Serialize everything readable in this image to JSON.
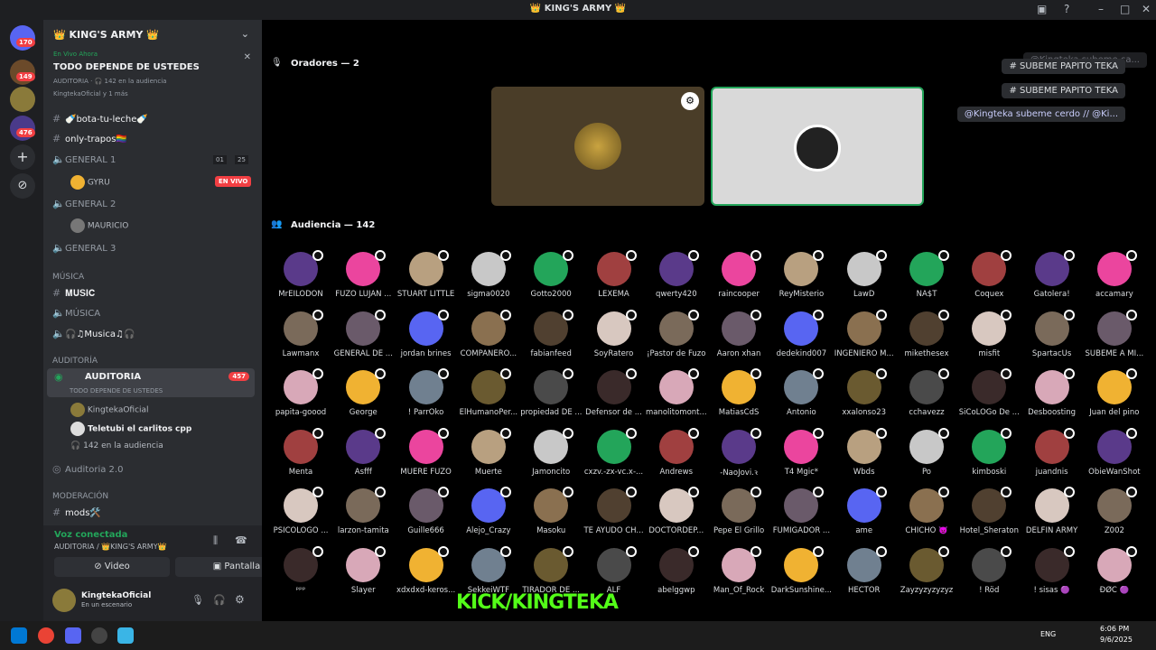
{
  "window": {
    "title": "👑 KING'S ARMY 👑"
  },
  "guilds": {
    "badges": [
      "170",
      "149",
      "476"
    ]
  },
  "server": {
    "name": "👑 KING'S ARMY 👑"
  },
  "live_banner": {
    "status": "En Vivo Ahora",
    "title": "TODO DEPENDE DE USTEDES",
    "sub1": "AUDITORIA · 🎧 142 en la audiencia",
    "sub2": "KingtekaOficial y 1 más"
  },
  "channels": {
    "bota": "🍼bota-tu-leche🍼",
    "only": "only-trapos🏳️‍🌈",
    "general1": "GENERAL 1",
    "general1_counts": [
      "01",
      "25"
    ],
    "gyru": "GYRU",
    "en_vivo": "EN VIVO",
    "general2": "GENERAL 2",
    "mauricio": "MAURICIO",
    "general3": "GENERAL 3",
    "musica_cat": "MÚSICA",
    "music": "𝐌𝐔𝐒𝐈𝐂",
    "musica": "MÚSICA",
    "musica2": "🎧♫Musica♫🎧",
    "auditoria_cat": "AUDITORÍA",
    "auditoria": "AUDITORIA",
    "auditoria_count": "457",
    "auditoria_topic": "TODO DEPENDE DE USTEDES",
    "user1": "KingtekaOficial",
    "user2": "Teletubi el carlitos cpp",
    "audience": "142 en la audiencia",
    "auditoria2": "Auditoria 2.0",
    "moderacion_cat": "MODERACIÓN",
    "mods": "mods🛠️"
  },
  "voice": {
    "status": "Voz conectada",
    "location": "AUDITORIA / 👑KING'S ARMY👑",
    "video": "Video",
    "screen": "Pantalla"
  },
  "user": {
    "name": "KingtekaOficial",
    "status": "En un escenario"
  },
  "stage": {
    "speakers_title": "Oradores — 2",
    "audience_title": "Audiencia — 142"
  },
  "chat": [
    "@Kingteka subeme ca...",
    "# SUBEME PAPITO TEKA",
    "# SUBEME PAPITO TEKA",
    "@Kingteka subeme cerdo // @Ki..."
  ],
  "audience": [
    [
      "MrEILODON",
      "FUZO LUJAN ...",
      "STUART LITTLE",
      "sigma0020",
      "Gotto2000",
      "LEXEMA",
      "qwerty420",
      "raincooper",
      "ReyMisterio",
      "LawD",
      "NA$T",
      "Coquex",
      "Gatolera!",
      "accamary"
    ],
    [
      "Lawmanx",
      "GENERAL DE ...",
      "jordan brines",
      "COMPAÑERO...",
      "fabianfeed",
      "SoyRatero",
      "¡Pastor de Fuzo",
      "Aaron xhan",
      "dedekind007",
      "INGENIERO M...",
      "mikethesex",
      "misfit",
      "SpartacUs",
      "SUBEME A MI..."
    ],
    [
      "papita-goood",
      "George",
      "! ParrOko",
      "ElHumanoPer...",
      "propiedad DE ...",
      "Defensor de ...",
      "manolitomont...",
      "MatiasCdS",
      "Antonio",
      "xxalonso23",
      "cchavezz",
      "SiCoLOGo De ...",
      "Desboosting",
      "Juan del pino"
    ],
    [
      "Menta",
      "Asfff",
      "MUERE FUZO",
      "Muerte",
      "Jamoncito",
      "cxzv.-zx-vc.x-...",
      "Andrews",
      "-NaoJovi.ꝛ",
      "T4 Mgic*",
      "Wbds",
      "Po",
      "kimboski",
      "juandnis",
      "ObieWanShot"
    ],
    [
      "PSICOLOGO ...",
      "larzon-tamita",
      "Guille666",
      "Alejo_Crazy",
      "Masoku",
      "TE AYUDO CH...",
      "DOCTORDEP...",
      "Pepe El Grillo",
      "FUMIGADOR ...",
      "ame",
      "CHICHO 👿",
      "Hotel_Sheraton",
      "DELFIN ARMY",
      "Z002"
    ],
    [
      "ᵖᵖᵖ",
      "Slayer",
      "xdxdxd-keros...",
      "SekkeiWTF",
      "TIRADOR DE ...",
      "ALF",
      "abelggwp",
      "Man_Of_Rock",
      "DarkSunshine...",
      "HÉCTOR",
      "Zayzyzyzyzyz",
      "! Röd",
      "! sisas 🟣",
      "ĐØĈ 🟣"
    ]
  ],
  "overlay": {
    "kick": "KICK/KINGTEKA"
  },
  "taskbar": {
    "lang": "ENG",
    "time": "6:06 PM",
    "date": "9/6/2025"
  },
  "colors": {
    "accent": "#5865f2",
    "live": "#23a55a",
    "kick": "#53fc18",
    "red": "#f23f43"
  }
}
